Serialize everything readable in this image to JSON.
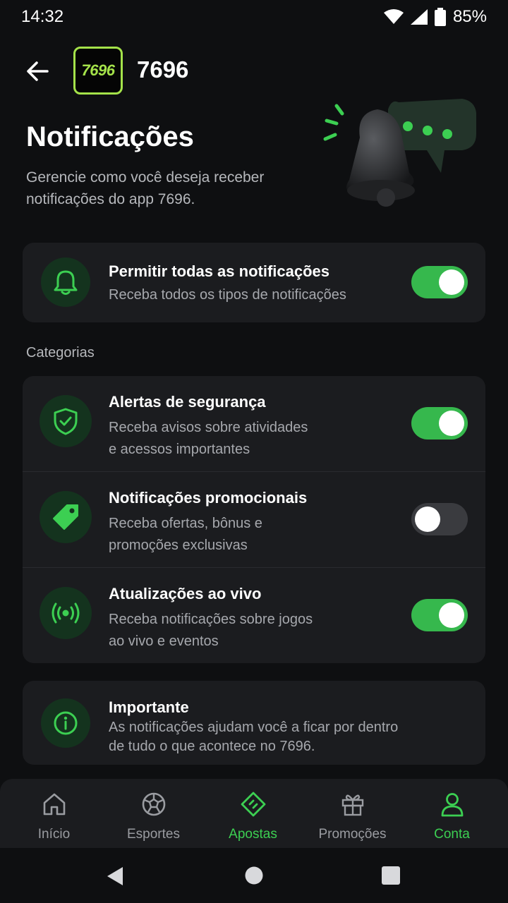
{
  "status": {
    "time": "14:32",
    "battery": "85%"
  },
  "header": {
    "logo_text": "7696",
    "app_name": "7696"
  },
  "page": {
    "title": "Notificações",
    "description": "Gerencie como você deseja receber notificações do app 7696."
  },
  "master": {
    "title": "Permitir todas as notificações",
    "subtitle": "Receba todos os tipos de notificações",
    "enabled": true
  },
  "categories_label": "Categorias",
  "categories": [
    {
      "title": "Alertas de segurança",
      "line1": "Receba avisos sobre atividades",
      "line2": "e acessos importantes",
      "enabled": true,
      "icon": "shield-check-icon"
    },
    {
      "title": "Notificações promocionais",
      "line1": "Receba ofertas, bônus e",
      "line2": "promoções exclusivas",
      "enabled": false,
      "icon": "tag-icon"
    },
    {
      "title": "Atualizações ao vivo",
      "line1": "Receba notificações sobre jogos",
      "line2": "ao vivo e eventos",
      "enabled": true,
      "icon": "live-broadcast-icon"
    }
  ],
  "info": {
    "title": "Importante",
    "line1": "As notificações ajudam você a ficar por dentro",
    "line2": "de tudo o que acontece no 7696."
  },
  "nav": [
    {
      "label": "Início",
      "icon": "home-icon",
      "active": false
    },
    {
      "label": "Esportes",
      "icon": "soccer-ball-icon",
      "active": false
    },
    {
      "label": "Apostas",
      "icon": "ticket-icon",
      "active": true
    },
    {
      "label": "Promoções",
      "icon": "gift-icon",
      "active": false
    },
    {
      "label": "Conta",
      "icon": "user-icon",
      "active": true
    }
  ],
  "colors": {
    "accent": "#36b84d",
    "background": "#0e0f11",
    "card": "#1b1c1f",
    "logo": "#a4e24a"
  }
}
